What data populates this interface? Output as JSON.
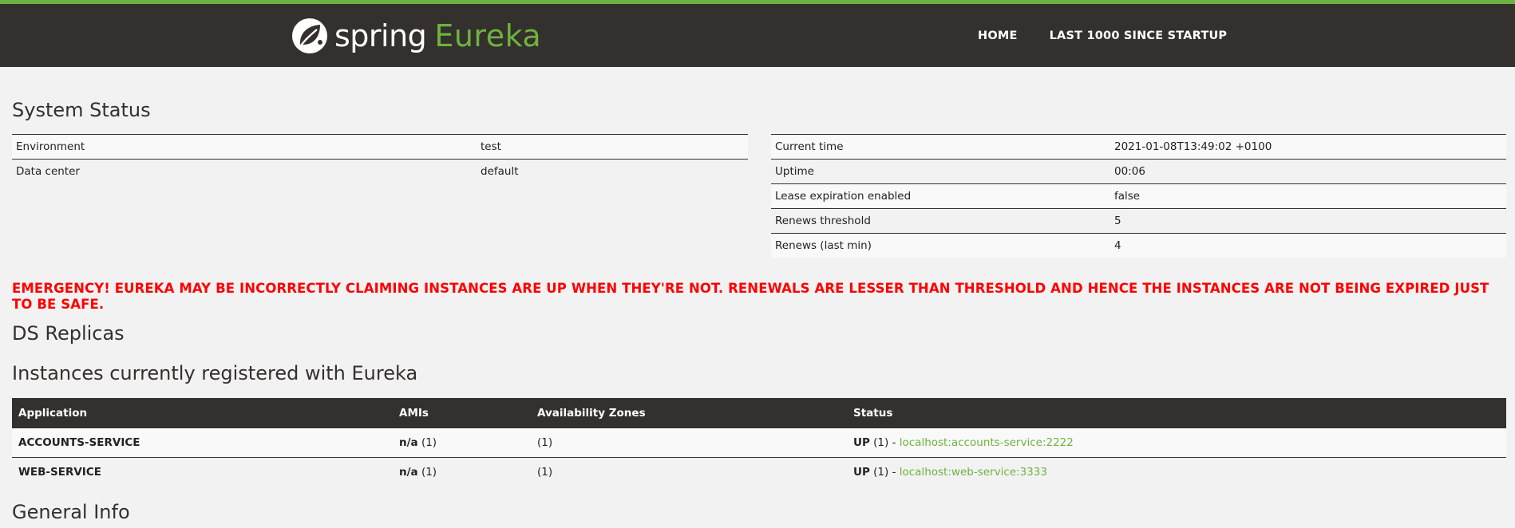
{
  "brand": {
    "spring": "spring",
    "eureka": "Eureka"
  },
  "nav": {
    "home": "HOME",
    "last": "LAST 1000 SINCE STARTUP"
  },
  "system_status": {
    "title": "System Status",
    "left": [
      {
        "label": "Environment",
        "value": "test"
      },
      {
        "label": "Data center",
        "value": "default"
      }
    ],
    "right": [
      {
        "label": "Current time",
        "value": "2021-01-08T13:49:02 +0100"
      },
      {
        "label": "Uptime",
        "value": "00:06"
      },
      {
        "label": "Lease expiration enabled",
        "value": "false"
      },
      {
        "label": "Renews threshold",
        "value": "5"
      },
      {
        "label": "Renews (last min)",
        "value": "4"
      }
    ]
  },
  "emergency": "EMERGENCY! EUREKA MAY BE INCORRECTLY CLAIMING INSTANCES ARE UP WHEN THEY'RE NOT. RENEWALS ARE LESSER THAN THRESHOLD AND HENCE THE INSTANCES ARE NOT BEING EXPIRED JUST TO BE SAFE.",
  "ds_replicas": {
    "title": "DS Replicas"
  },
  "instances": {
    "title": "Instances currently registered with Eureka",
    "headers": [
      "Application",
      "AMIs",
      "Availability Zones",
      "Status"
    ],
    "rows": [
      {
        "application": "ACCOUNTS-SERVICE",
        "ami": "n/a",
        "ami_count": "(1)",
        "zones": "(1)",
        "status": "UP",
        "status_count": "(1) -",
        "link": "localhost:accounts-service:2222"
      },
      {
        "application": "WEB-SERVICE",
        "ami": "n/a",
        "ami_count": "(1)",
        "zones": "(1)",
        "status": "UP",
        "status_count": "(1) -",
        "link": "localhost:web-service:3333"
      }
    ]
  },
  "general_info": {
    "title": "General Info"
  },
  "colors": {
    "header_bg": "#34302d",
    "accent": "#6db33f",
    "emergency": "#ff0000"
  }
}
